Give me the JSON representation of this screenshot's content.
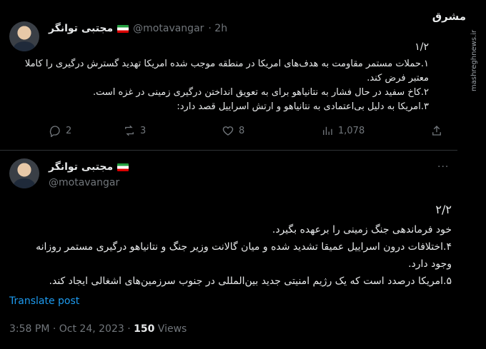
{
  "watermark": {
    "site": "mashreghnews.ir",
    "logo": "مشرق"
  },
  "tweet1": {
    "display_name": "مجتبی توانگر",
    "handle": "@motavangar",
    "time": "· 2h",
    "thread_index": "۱/۲",
    "body": "۱.حملات مستمر مقاومت به هدف‌های امریکا در منطقه موجب شده امریکا تهدید گسترش درگیری را کاملا\nمعتبر فرض کند.\n۲.کاخ سفید در حال فشار به نتانیاهو برای به تعویق انداختن درگیری زمینی در غزه است.\n۳.امریکا به دلیل بی‌اعتمادی به نتانیاهو و ارتش اسراییل قصد دارد:",
    "replies": "2",
    "retweets": "3",
    "likes": "8",
    "views": "1,078"
  },
  "tweet2": {
    "display_name": "مجتبی توانگر",
    "handle": "@motavangar",
    "thread_index": "۲/۲",
    "body": "خود فرماندهی جنگ زمینی را برعهده بگیرد.\n۴.اختلافات درون اسراییل عمیقا تشدید شده و میان گالانت وزیر جنگ و نتانیاهو درگیری مستمر روزانه\nوجود دارد.\n۵.امریکا درصدد است که یک رژیم امنیتی جدید بین‌المللی در جنوب سرزمین‌های اشغالی ایجاد کند.",
    "translate_label": "Translate post",
    "timestamp": "3:58 PM · Oct 24, 2023 · ",
    "view_count": "150",
    "views_label": " Views"
  }
}
